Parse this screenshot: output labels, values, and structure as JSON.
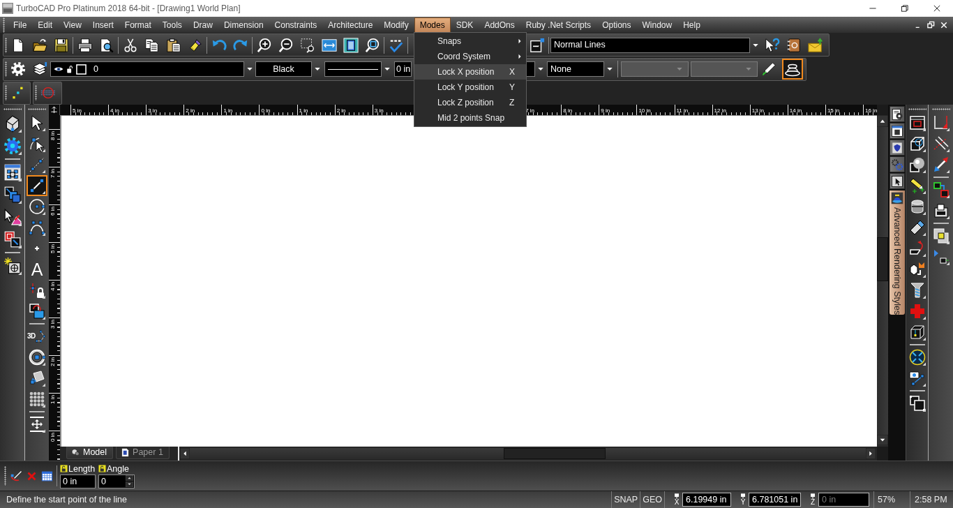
{
  "window": {
    "title": "TurboCAD Pro Platinum 2018 64-bit - [Drawing1 World Plan]"
  },
  "menu_bar": {
    "items": [
      {
        "label": "File",
        "selected": false
      },
      {
        "label": "Edit",
        "selected": false
      },
      {
        "label": "View",
        "selected": false
      },
      {
        "label": "Insert",
        "selected": false
      },
      {
        "label": "Format",
        "selected": false
      },
      {
        "label": "Tools",
        "selected": false
      },
      {
        "label": "Draw",
        "selected": false
      },
      {
        "label": "Dimension",
        "selected": false
      },
      {
        "label": "Constraints",
        "selected": false
      },
      {
        "label": "Architecture",
        "selected": false
      },
      {
        "label": "Modify",
        "selected": false
      },
      {
        "label": "Modes",
        "selected": true
      },
      {
        "label": "SDK",
        "selected": false
      },
      {
        "label": "AddOns",
        "selected": false
      },
      {
        "label": "Ruby .Net Scripts",
        "selected": false
      },
      {
        "label": "Options",
        "selected": false
      },
      {
        "label": "Window",
        "selected": false
      },
      {
        "label": "Help",
        "selected": false
      }
    ]
  },
  "open_menu": {
    "items": [
      {
        "label": "Snaps",
        "submenu": true,
        "selected": false
      },
      {
        "label": "Coord System",
        "submenu": true,
        "selected": false
      },
      {
        "label": "Lock X position",
        "shortcut": "X",
        "submenu": false,
        "selected": true
      },
      {
        "label": "Lock Y position",
        "shortcut": "Y",
        "submenu": false,
        "selected": false
      },
      {
        "label": "Lock Z position",
        "shortcut": "Z",
        "submenu": false,
        "selected": false
      },
      {
        "label": "Mid 2 points Snap",
        "submenu": false,
        "selected": false
      }
    ]
  },
  "standard_toolbar": {
    "line_preset": "Normal Lines"
  },
  "property_toolbar": {
    "layer": "0",
    "ink": "Black",
    "line_width": "0 in",
    "fill": "None",
    "extra_dropdowns": [
      {
        "disabled": true
      },
      {
        "disabled": true
      }
    ],
    "render_toggle": {
      "on": true
    }
  },
  "draw_toolbar": {
    "tools": [
      {
        "selected": false
      },
      {
        "selected": false
      },
      {
        "selected": false
      },
      {
        "selected": true
      },
      {
        "selected": false
      },
      {
        "selected": false
      },
      {
        "selected": false
      },
      {
        "selected": false,
        "glyph": "A"
      },
      {
        "selected": false
      },
      {
        "selected": false
      },
      {
        "selected": false,
        "glyph": "3D"
      },
      {
        "selected": false
      },
      {
        "selected": false
      },
      {
        "selected": false
      },
      {
        "selected": false
      }
    ]
  },
  "palette_tab": {
    "label": "Advanced Rendering Styles"
  },
  "rulers": {
    "horizontal_runs": [
      [
        "5 in",
        "4 in",
        "3 in",
        "2 in",
        "1 in",
        "0 in",
        "1 in",
        "2 in",
        "3 in"
      ],
      [
        "7 in",
        "8 in",
        "9 in",
        "10 in",
        "11 in",
        "12 in",
        "13 in",
        "14 in",
        "15 in",
        "16 in"
      ]
    ],
    "vertical": [
      "8 in",
      "7 in",
      "6 in",
      "5 in",
      "4 in",
      "3 in",
      "2 in",
      "1 in",
      "0 in"
    ]
  },
  "document_tabs": [
    {
      "label": "Model",
      "selected": true
    },
    {
      "label": "Paper 1",
      "selected": false
    }
  ],
  "input_bar": {
    "fields": [
      {
        "label": "Length",
        "value": "0 in",
        "kind": "text"
      },
      {
        "label": "Angle",
        "value": "0",
        "kind": "spinner"
      }
    ]
  },
  "status_bar": {
    "prompt": "Define the start point of the line",
    "modes": [
      "SNAP",
      "GEO"
    ],
    "coordinates": [
      {
        "axis": "X",
        "value": "6.19949 in",
        "disabled": false
      },
      {
        "axis": "Y",
        "value": "6.781051 in",
        "disabled": false
      },
      {
        "axis": "Z",
        "value": "0 in",
        "disabled": true
      }
    ],
    "zoom": "57%",
    "time": "2:58 PM"
  }
}
